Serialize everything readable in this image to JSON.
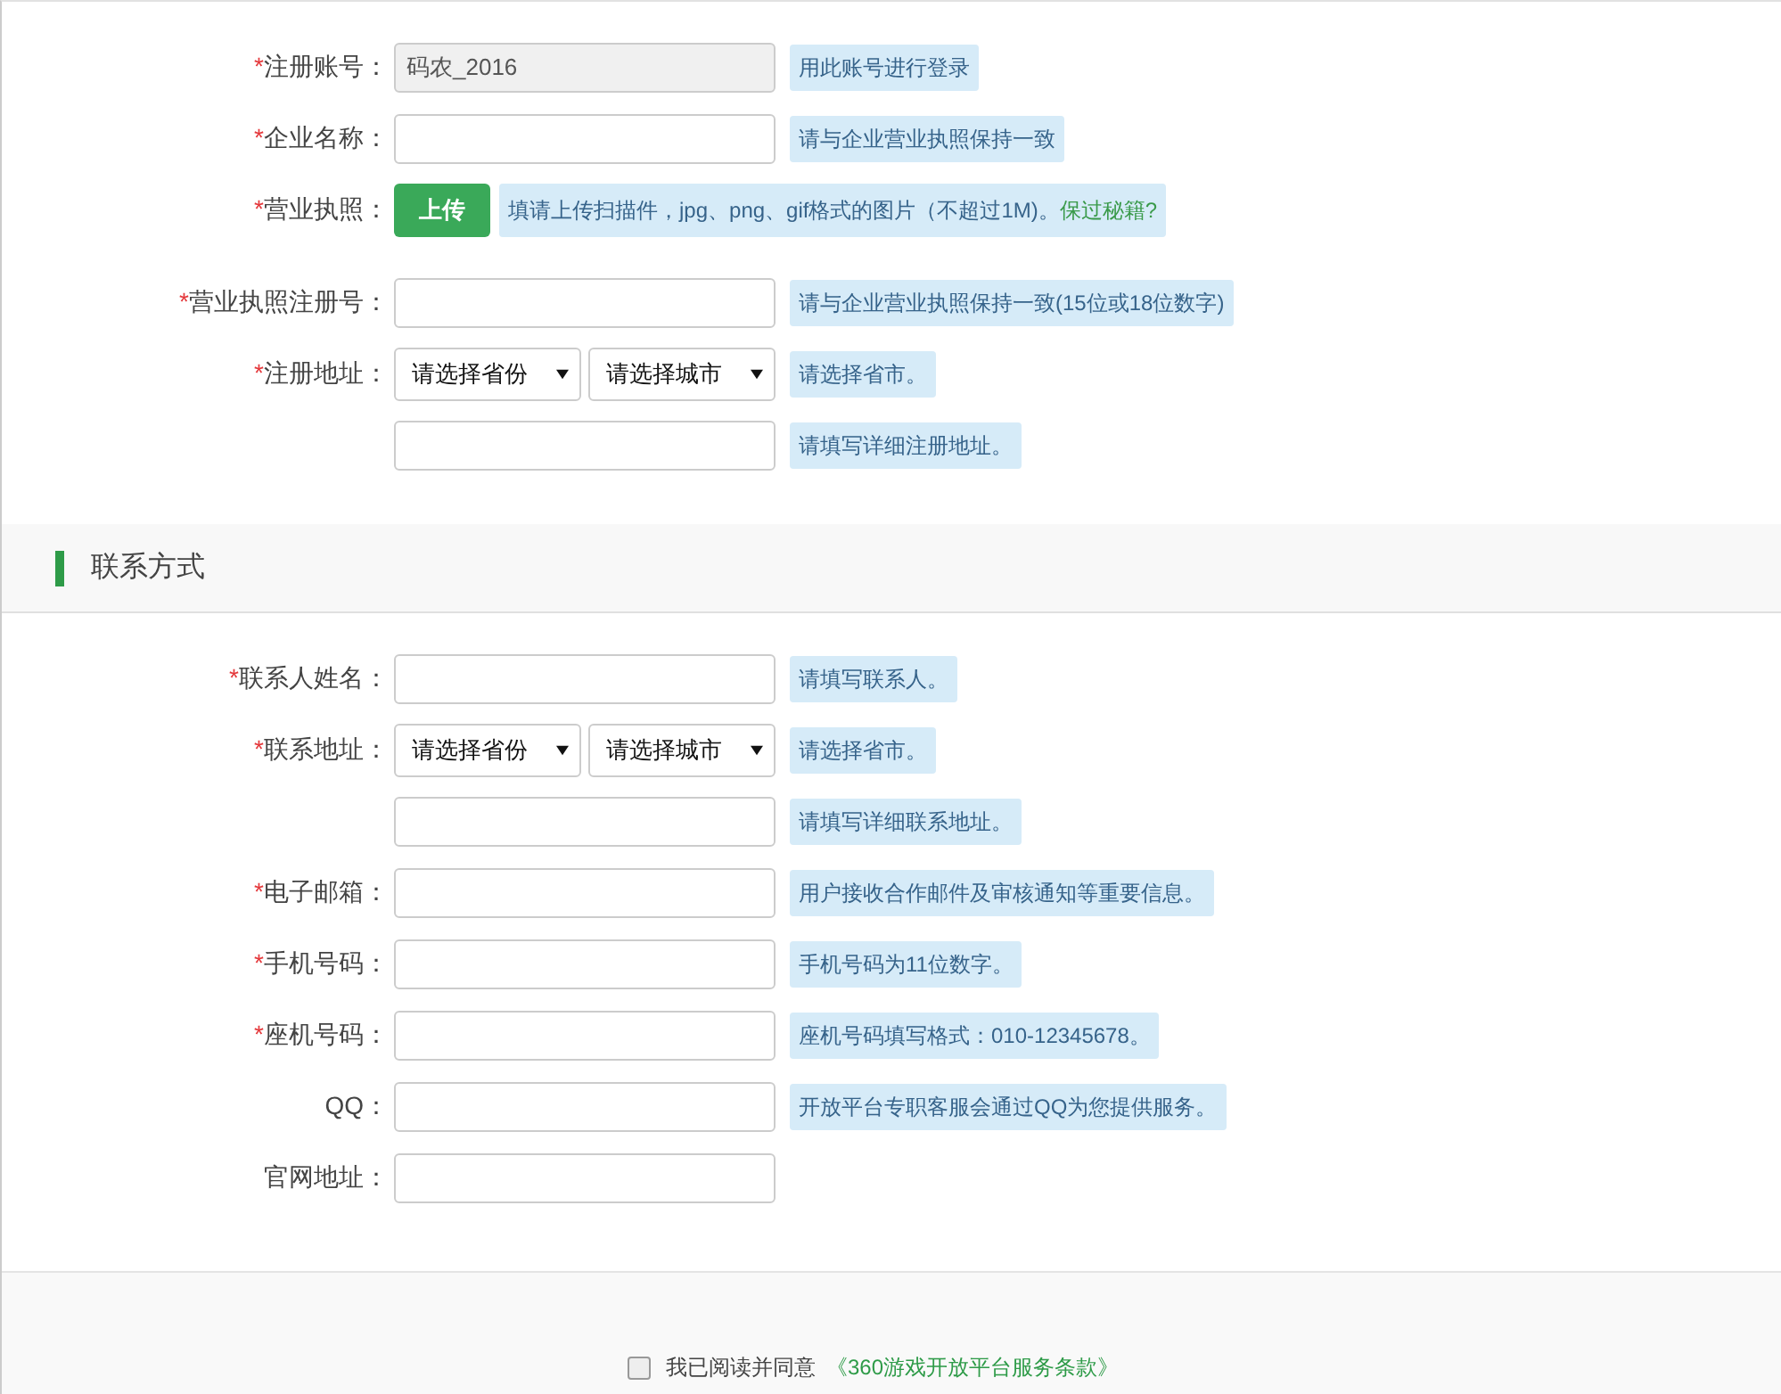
{
  "required_mark": "*",
  "company_fields": [
    {
      "kind": "text",
      "label": "注册账号：",
      "required": true,
      "value": "码农_2016",
      "disabled": true,
      "hint": "用此账号进行登录"
    },
    {
      "kind": "text",
      "label": "企业名称：",
      "required": true,
      "hint": "请与企业营业执照保持一致"
    },
    {
      "kind": "upload",
      "label": "营业执照：",
      "required": true,
      "button": "上传",
      "hint": "填请上传扫描件，jpg、png、gif格式的图片（不超过1M)。",
      "hint_link": "保过秘籍?"
    },
    {
      "kind": "text",
      "label": "营业执照注册号：",
      "required": true,
      "hint": "请与企业营业执照保持一致(15位或18位数字)"
    },
    {
      "kind": "select",
      "label": "注册地址：",
      "required": true,
      "province": "请选择省份",
      "city": "请选择城市",
      "hint": "请选择省市。"
    },
    {
      "kind": "text",
      "hint": "请填写详细注册地址。"
    }
  ],
  "contact_section": {
    "title": "联系方式"
  },
  "contact_fields": [
    {
      "kind": "text",
      "label": "联系人姓名：",
      "required": true,
      "hint": "请填写联系人。"
    },
    {
      "kind": "select",
      "label": "联系地址：",
      "required": true,
      "province": "请选择省份",
      "city": "请选择城市",
      "hint": "请选择省市。"
    },
    {
      "kind": "text",
      "hint": "请填写详细联系地址。"
    },
    {
      "kind": "text",
      "label": "电子邮箱：",
      "required": true,
      "hint": "用户接收合作邮件及审核通知等重要信息。"
    },
    {
      "kind": "text",
      "label": "手机号码：",
      "required": true,
      "hint": "手机号码为11位数字。"
    },
    {
      "kind": "text",
      "label": "座机号码：",
      "required": true,
      "hint": "座机号码填写格式：010-12345678。"
    },
    {
      "kind": "text",
      "label": "QQ：",
      "required": false,
      "hint": "开放平台专职客服会通过QQ为您提供服务。"
    },
    {
      "kind": "text",
      "label": "官网地址：",
      "required": false
    }
  ],
  "agreement": {
    "checked": false,
    "text": "我已阅读并同意",
    "link": "《360游戏开放平台服务条款》"
  }
}
